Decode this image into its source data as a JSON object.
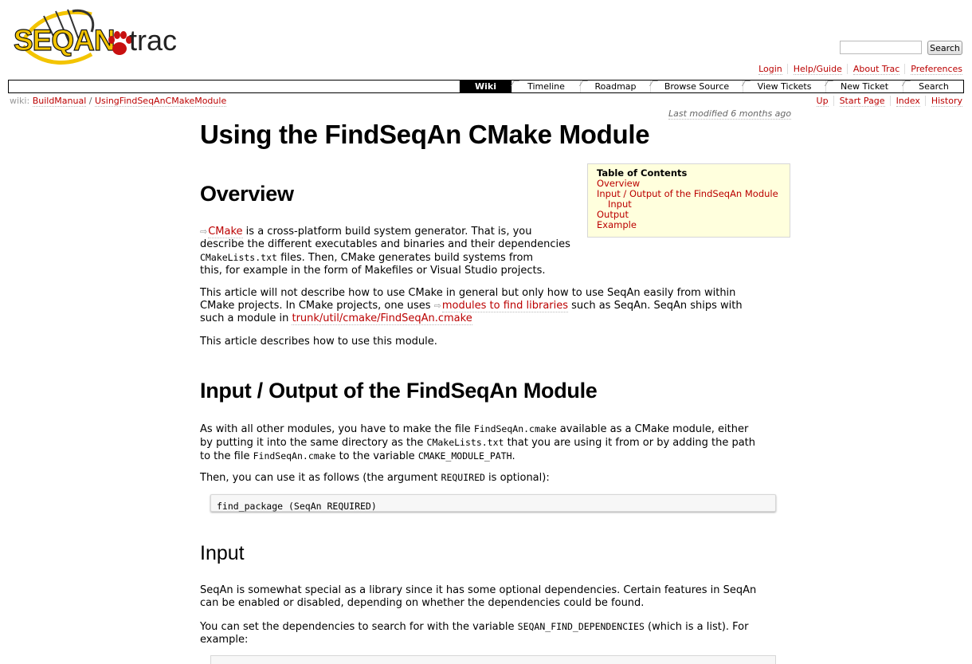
{
  "logo": {
    "seqan": "SEQAN",
    "trac": "trac"
  },
  "search": {
    "button_label": "Search",
    "value": ""
  },
  "metanav": [
    "Login",
    "Help/Guide",
    "About Trac",
    "Preferences"
  ],
  "mainnav": [
    "Wiki",
    "Timeline",
    "Roadmap",
    "Browse Source",
    "View Tickets",
    "New Ticket",
    "Search"
  ],
  "breadcrumb": {
    "label": "wiki:",
    "items": [
      "BuildManual",
      "UsingFindSeqAnCMakeModule"
    ],
    "sep": "/"
  },
  "ctxtnav": [
    "Up",
    "Start Page",
    "Index",
    "History"
  ],
  "last_modified": "Last modified 6 months ago",
  "page_title": "Using the FindSeqAn CMake Module",
  "toc": {
    "title": "Table of Contents",
    "items": [
      "Overview",
      "Input / Output of the FindSeqAn Module",
      "Input",
      "Output",
      "Example"
    ]
  },
  "overview": {
    "heading": "Overview",
    "p1_link": "CMake",
    "p1_a": " is a cross-platform build system generator. That is, you",
    "p1_b": "describe the different executables and binaries and their dependencies",
    "p1_code": "CMakeLists.txt",
    "p1_c": " files. Then, CMake generates build systems from",
    "p1_d": "this, for example in the form of Makefiles or Visual Studio projects.",
    "p2_a": "This article will not describe how to use CMake in general but only how to use SeqAn easily from within",
    "p2_b": "CMake projects. In CMake projects, one uses ",
    "p2_link1": "modules to find libraries",
    "p2_c": " such as SeqAn. SeqAn ships with",
    "p2_d": "such a module in ",
    "p2_link2": "trunk/util/cmake/FindSeqAn.cmake",
    "p3": "This article describes how to use this module."
  },
  "io": {
    "heading": "Input / Output of the FindSeqAn Module",
    "l1_a": "As with all other modules, you have to make the file ",
    "l1_code": "FindSeqAn.cmake",
    "l1_b": " available as a CMake module, either",
    "l2_a": "by putting it into the same directory as the ",
    "l2_code": "CMakeLists.txt",
    "l2_b": " that you are using it from or by adding the path",
    "l3_a": "to the file ",
    "l3_code1": "FindSeqAn.cmake",
    "l3_b": " to the variable ",
    "l3_code2": "CMAKE_MODULE_PATH",
    "l3_c": ".",
    "p2_a": "Then, you can use it as follows (the argument ",
    "p2_code": "REQUIRED",
    "p2_b": " is optional):",
    "code": "find_package (SeqAn REQUIRED)"
  },
  "input": {
    "heading": "Input",
    "p1_a": "SeqAn is somewhat special as a library since it has some optional dependencies. Certain features in SeqAn",
    "p1_b": "can be enabled or disabled, depending on whether the dependencies could be found.",
    "p2_a": "You can set the dependencies to search for with the variable ",
    "p2_code": "SEQAN_FIND_DEPENDENCIES",
    "p2_b": " (which is a list). For",
    "p2_c": "example:"
  }
}
